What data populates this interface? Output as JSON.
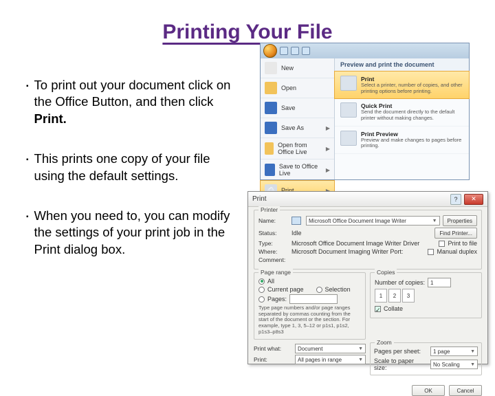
{
  "title": "Printing Your File",
  "bullets": {
    "b1_a": "To print out your document click on the Office Button, and then click ",
    "b1_b": "Print.",
    "b2": "This prints one copy of your file using the default settings.",
    "b3": "When you need to, you can modify the settings of your print job in the Print dialog box."
  },
  "office_menu": {
    "left_items": [
      "New",
      "Open",
      "Save",
      "Save As",
      "Open from Office Live",
      "Save to Office Live",
      "Print"
    ],
    "right_header": "Preview and print the document",
    "r1_title": "Print",
    "r1_desc": "Select a printer, number of copies, and other printing options before printing.",
    "r2_title": "Quick Print",
    "r2_desc": "Send the document directly to the default printer without making changes.",
    "r3_title": "Print Preview",
    "r3_desc": "Preview and make changes to pages before printing."
  },
  "print_dialog": {
    "title": "Print",
    "printer_legend": "Printer",
    "name_label": "Name:",
    "printer_name": "Microsoft Office Document Image Writer",
    "status_label": "Status:",
    "status_value": "Idle",
    "type_label": "Type:",
    "type_value": "Microsoft Office Document Image Writer Driver",
    "where_label": "Where:",
    "where_value": "Microsoft Document Imaging Writer Port:",
    "comment_label": "Comment:",
    "props_btn": "Properties",
    "find_btn": "Find Printer...",
    "print_to_file": "Print to file",
    "manual_duplex": "Manual duplex",
    "range_legend": "Page range",
    "all": "All",
    "current": "Current page",
    "selection": "Selection",
    "pages": "Pages:",
    "pages_hint": "Type page numbers and/or page ranges separated by commas counting from the start of the document or the section. For example, type 1, 3, 5–12 or p1s1, p1s2, p1s3–p8s3",
    "copies_legend": "Copies",
    "num_copies": "Number of copies:",
    "copies_val": "1",
    "collate": "Collate",
    "print_what_label": "Print what:",
    "print_what_value": "Document",
    "print_label": "Print:",
    "print_value": "All pages in range",
    "zoom_legend": "Zoom",
    "pps_label": "Pages per sheet:",
    "pps_value": "1 page",
    "scale_label": "Scale to paper size:",
    "scale_value": "No Scaling",
    "ok": "OK",
    "cancel": "Cancel"
  }
}
